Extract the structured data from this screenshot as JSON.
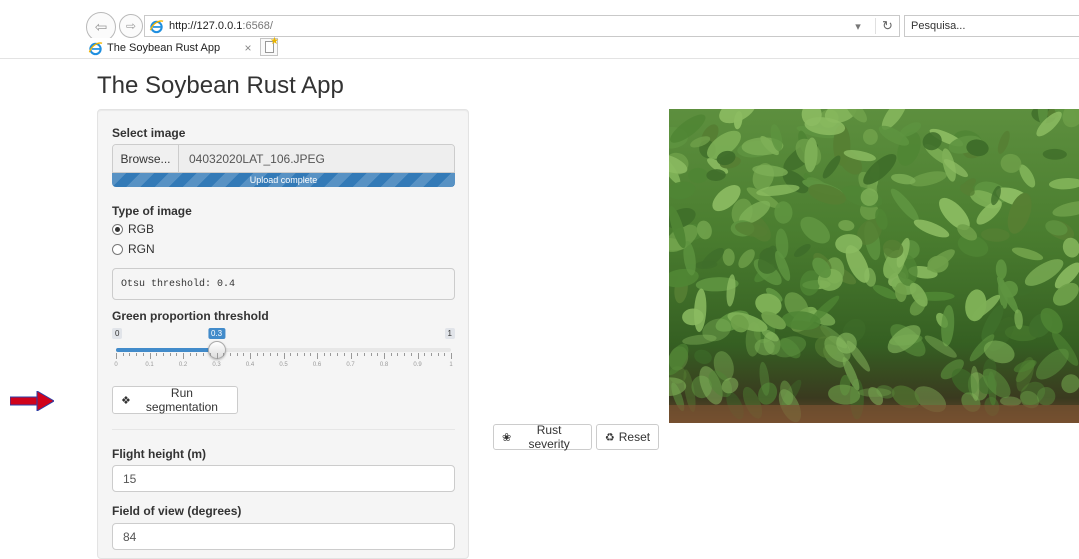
{
  "browser": {
    "url_host": "http://127.0.0.1",
    "url_port": ":6568/",
    "search_placeholder": "Pesquisa...",
    "tab_title": "The Soybean Rust App",
    "tab_close": "×"
  },
  "app": {
    "title": "The Soybean Rust App"
  },
  "sidebar": {
    "select_image_label": "Select image",
    "browse_label": "Browse...",
    "file_name": "04032020LAT_106.JPEG",
    "upload_status": "Upload complete",
    "upload_progress": 1.0,
    "type_label": "Type of image",
    "type_options": [
      {
        "label": "RGB",
        "checked": true
      },
      {
        "label": "RGN",
        "checked": false
      }
    ],
    "otsu_text": "Otsu threshold: 0.4",
    "green_label": "Green proportion threshold",
    "slider": {
      "min": 0,
      "max": 1,
      "value": 0.3,
      "min_label": "0",
      "max_label": "1",
      "value_label": "0.3",
      "tick_labels": [
        "0",
        "0.1",
        "0.2",
        "0.3",
        "0.4",
        "0.5",
        "0.6",
        "0.7",
        "0.8",
        "0.9",
        "1"
      ]
    },
    "run_label": "Run segmentation",
    "flight_label": "Flight height (m)",
    "flight_value": "15",
    "fov_label": "Field of view (degrees)",
    "fov_value": "84"
  },
  "main": {
    "rust_label": "Rust severity",
    "reset_label": "Reset"
  },
  "colors": {
    "accent": "#337ab7",
    "slider_fill": "#428bca",
    "arrow": "#d0021b"
  }
}
